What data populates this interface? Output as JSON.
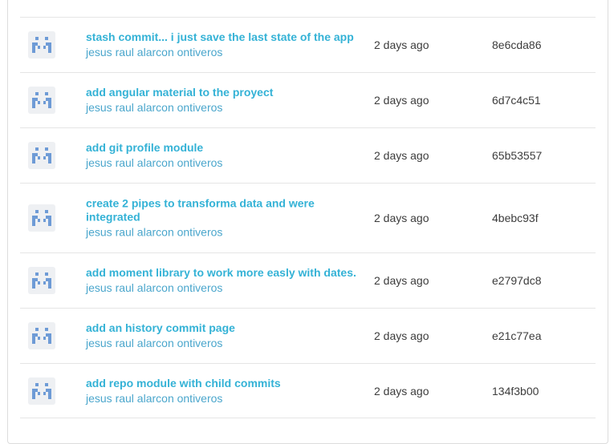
{
  "commits": [
    {
      "message": "stash commit... i just save the last state of the app",
      "author": "jesus raul alarcon ontiveros",
      "date": "2 days ago",
      "sha": "8e6cda86"
    },
    {
      "message": "add angular material to the proyect",
      "author": "jesus raul alarcon ontiveros",
      "date": "2 days ago",
      "sha": "6d7c4c51"
    },
    {
      "message": "add git profile module",
      "author": "jesus raul alarcon ontiveros",
      "date": "2 days ago",
      "sha": "65b53557"
    },
    {
      "message": "create 2 pipes to transforma data and were integrated",
      "author": "jesus raul alarcon ontiveros",
      "date": "2 days ago",
      "sha": "4bebc93f"
    },
    {
      "message": "add moment library to work more easly with dates.",
      "author": "jesus raul alarcon ontiveros",
      "date": "2 days ago",
      "sha": "e2797dc8"
    },
    {
      "message": "add an history commit page",
      "author": "jesus raul alarcon ontiveros",
      "date": "2 days ago",
      "sha": "e21c77ea"
    },
    {
      "message": "add repo module with child commits",
      "author": "jesus raul alarcon ontiveros",
      "date": "2 days ago",
      "sha": "134f3b00"
    }
  ],
  "avatar_icon": "identicon-icon",
  "colors": {
    "link": "#34b2d6",
    "author": "#4aa6cc",
    "identicon": "#6e9bd6",
    "text": "#3c3c3c"
  }
}
